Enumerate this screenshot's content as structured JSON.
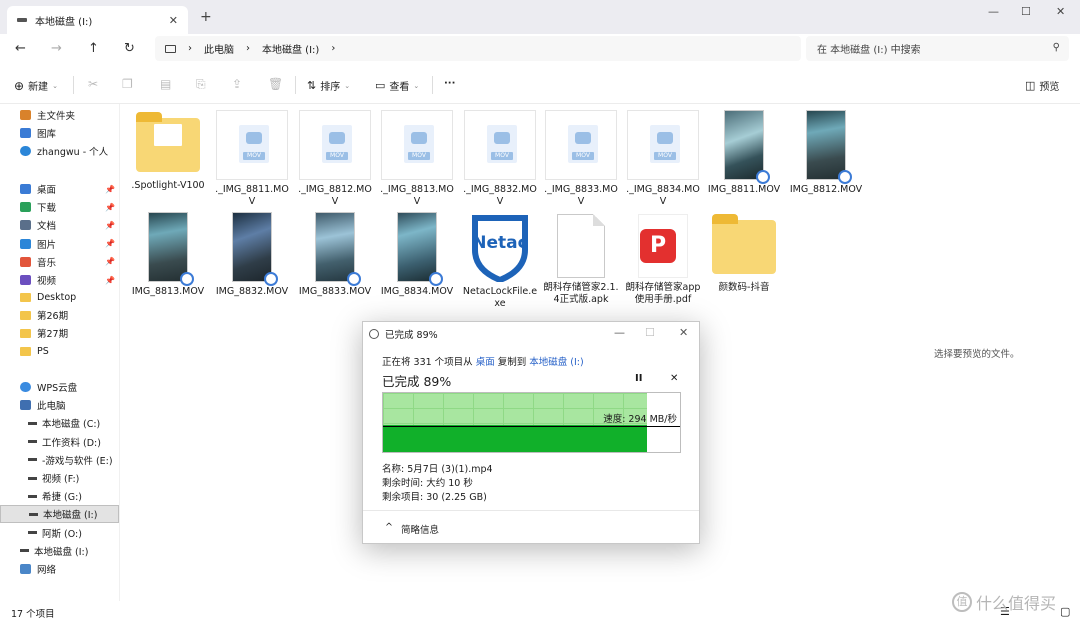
{
  "window": {
    "tab_title": "本地磁盘 (I:)",
    "tab_close": "✕",
    "new_tab": "+",
    "min": "—",
    "max": "☐",
    "close": "✕"
  },
  "nav": {
    "back": "←",
    "forward": "→",
    "up": "↑",
    "refresh": "↻",
    "breadcrumb": [
      "此电脑",
      "本地磁盘 (I:)"
    ],
    "search_placeholder": "在 本地磁盘 (I:) 中搜索"
  },
  "toolbar": {
    "new_label": "新建",
    "sort_label": "排序",
    "view_label": "查看",
    "more_label": "···",
    "preview_label": "预览"
  },
  "sidebar": {
    "quick": [
      {
        "label": "主文件夹",
        "color": "#d9822b"
      },
      {
        "label": "图库",
        "color": "#3a7bd5"
      },
      {
        "label": "zhangwu - 个人",
        "color": "#2b86d8"
      }
    ],
    "pinned": [
      {
        "label": "桌面",
        "color": "#3a7bd5"
      },
      {
        "label": "下载",
        "color": "#2aa05a"
      },
      {
        "label": "文档",
        "color": "#5a6f8a"
      },
      {
        "label": "图片",
        "color": "#2b86d8"
      },
      {
        "label": "音乐",
        "color": "#e2553b"
      },
      {
        "label": "视频",
        "color": "#6b4fbf"
      }
    ],
    "folders": [
      "Desktop",
      "第26期",
      "第27期",
      "PS"
    ],
    "devices": [
      {
        "label": "WPS云盘",
        "type": "cloud"
      },
      {
        "label": "此电脑",
        "type": "pc"
      },
      {
        "label": "本地磁盘 (C:)",
        "type": "drive"
      },
      {
        "label": "工作资料 (D:)",
        "type": "drive"
      },
      {
        "label": "-游戏与软件 (E:)",
        "type": "drive"
      },
      {
        "label": "视频 (F:)",
        "type": "drive"
      },
      {
        "label": "希捷 (G:)",
        "type": "drive"
      },
      {
        "label": "本地磁盘 (I:)",
        "type": "drive"
      },
      {
        "label": "阿斯 (O:)",
        "type": "drive"
      },
      {
        "label": "本地磁盘 (I:)",
        "type": "drive"
      },
      {
        "label": "网络",
        "type": "network"
      }
    ]
  },
  "files_row1": [
    ".Spotlight-V100",
    "._IMG_8811.MOV",
    "._IMG_8812.MOV",
    "._IMG_8813.MOV",
    "._IMG_8832.MOV",
    "._IMG_8833.MOV",
    "._IMG_8834.MOV",
    "IMG_8811.MOV",
    "IMG_8812.MOV"
  ],
  "files_row2": [
    "IMG_8813.MOV",
    "IMG_8832.MOV",
    "IMG_8833.MOV",
    "IMG_8834.MOV",
    "NetacLockFile.exe",
    "朗科存储管家2.1.4正式版.apk",
    "朗科存储管家app使用手册.pdf",
    "颜数码-抖音"
  ],
  "mov_badge": "MOV",
  "netac_logo": "Netac",
  "pdf_logo": "P",
  "preview_hint": "选择要预览的文件。",
  "status": {
    "count": "17 个项目"
  },
  "dialog": {
    "title": "已完成 89%",
    "line1_pre": "正在将 331 个项目从 ",
    "line1_src": "桌面",
    "line1_mid": " 复制到 ",
    "line1_dst": "本地磁盘 (I:)",
    "percent": "已完成 89%",
    "progress": 0.89,
    "pause": "II",
    "cancel": "✕",
    "speed": "速度: 294 MB/秒",
    "name": "名称: 5月7日 (3)(1).mp4",
    "time_left": "剩余时间: 大约 10 秒",
    "items_left": "剩余项目: 30 (2.25 GB)",
    "more": "简略信息",
    "chevron": "^"
  },
  "watermark": "什么值得买"
}
